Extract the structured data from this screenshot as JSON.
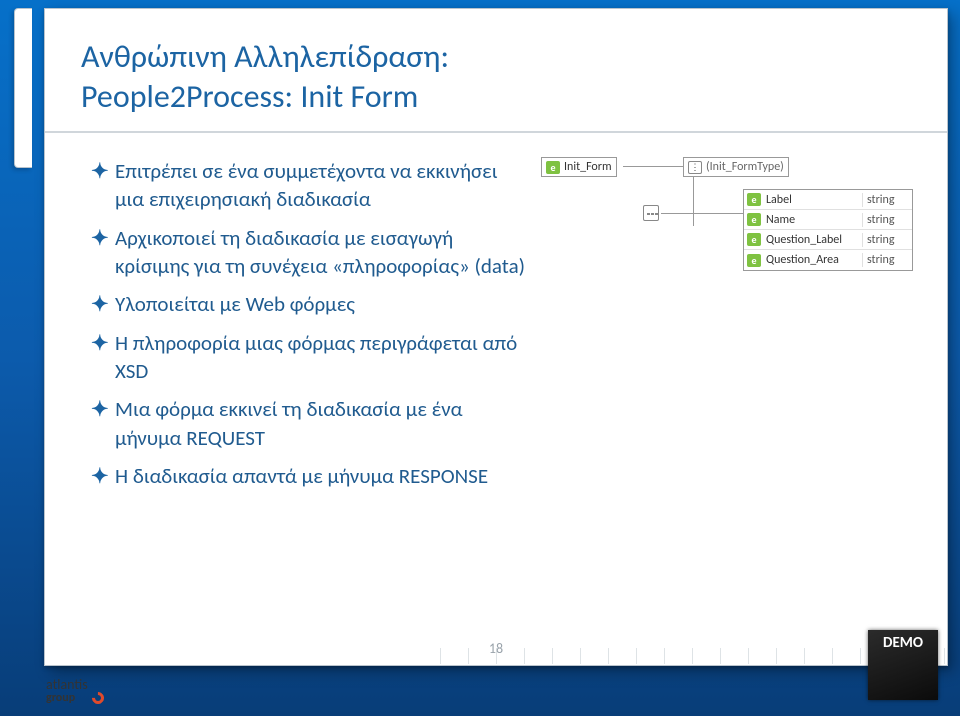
{
  "heading": {
    "line1": "Ανθρώπινη Αλληλεπίδραση:",
    "line2": "People2Process: Init Form"
  },
  "bullets": [
    "Επιτρέπει σε ένα συμμετέχοντα να εκκινήσει μια επιχειρησιακή διαδικασία",
    "Αρχικοποιεί τη διαδικασία με εισαγωγή κρίσιμης για τη συνέχεια «πληροφορίας» (data)",
    "Υλοποιείται με Web φόρμες",
    "Η πληροφορία μιας φόρμας περιγράφεται από XSD",
    "Μια φόρμα εκκινεί τη διαδικασία με ένα μήνυμα REQUEST",
    "Η διαδικασία απαντά με μήνυμα RESPONSE"
  ],
  "diagram": {
    "root_element": "Init_Form",
    "root_type": "(Init_FormType)",
    "properties": [
      {
        "name": "Label",
        "type": "string"
      },
      {
        "name": "Name",
        "type": "string"
      },
      {
        "name": "Question_Label",
        "type": "string"
      },
      {
        "name": "Question_Area",
        "type": "string"
      }
    ]
  },
  "footer": {
    "page_number": "18",
    "logo_line1": "atlantis",
    "logo_line2": "group",
    "demo_badge": "DEMO"
  }
}
